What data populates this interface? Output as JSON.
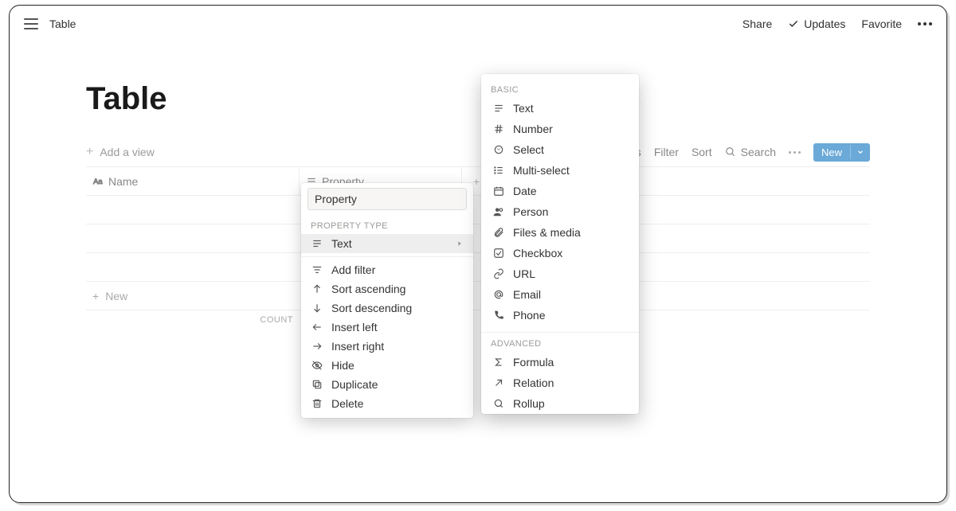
{
  "topbar": {
    "breadcrumb": "Table",
    "share": "Share",
    "updates": "Updates",
    "favorite": "Favorite"
  },
  "page": {
    "title": "Table",
    "add_view": "Add a view",
    "actions": {
      "properties": "rties",
      "filter": "Filter",
      "sort": "Sort",
      "search": "Search",
      "new": "New"
    }
  },
  "table": {
    "cols": {
      "name": "Name",
      "property": "Property"
    },
    "newrow": "New",
    "count_label": "COUNT"
  },
  "property_menu": {
    "input_value": "Property",
    "section_type": "PROPERTY TYPE",
    "current_type": "Text",
    "items": {
      "add_filter": "Add filter",
      "sort_asc": "Sort ascending",
      "sort_desc": "Sort descending",
      "insert_left": "Insert left",
      "insert_right": "Insert right",
      "hide": "Hide",
      "duplicate": "Duplicate",
      "delete": "Delete"
    }
  },
  "type_menu": {
    "basic_label": "BASIC",
    "advanced_label": "ADVANCED",
    "basic": {
      "text": "Text",
      "number": "Number",
      "select": "Select",
      "multi": "Multi-select",
      "date": "Date",
      "person": "Person",
      "files": "Files & media",
      "checkbox": "Checkbox",
      "url": "URL",
      "email": "Email",
      "phone": "Phone"
    },
    "advanced": {
      "formula": "Formula",
      "relation": "Relation",
      "rollup": "Rollup"
    }
  }
}
